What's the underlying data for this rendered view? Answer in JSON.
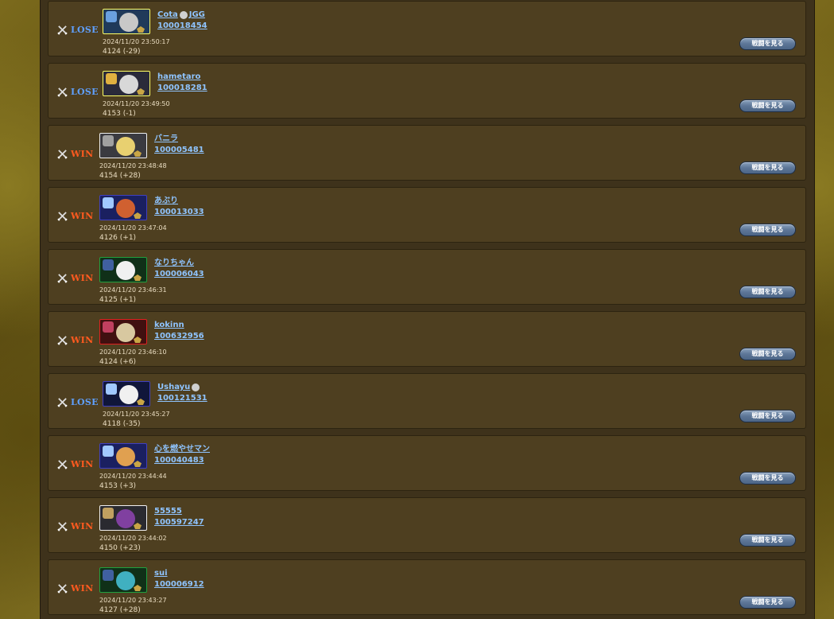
{
  "colors": {
    "win": "#ff5a1f",
    "lose": "#5fa0ff",
    "link": "#8fc4ff",
    "row_bg": "#4e3f20"
  },
  "icons": {
    "result": "crossed-swords-icon"
  },
  "rows": [
    {
      "result": "LOSE",
      "name": "Cota",
      "name_suffix": "JGG",
      "has_mid_icon": true,
      "player_id": "100018454",
      "datetime": "2024/11/20 23:50:17",
      "rating": "4124 (-29)",
      "button": "戦闘を見る",
      "frame": "#ffff66",
      "avatar_bg": "#203a5a",
      "face": "#c8c8c8",
      "char": "#6aa0e0"
    },
    {
      "result": "LOSE",
      "name": "hametaro",
      "name_suffix": "",
      "has_mid_icon": false,
      "player_id": "100018281",
      "datetime": "2024/11/20 23:49:50",
      "rating": "4153 (-1)",
      "button": "戦闘を見る",
      "frame": "#ffff66",
      "avatar_bg": "#2a2a3a",
      "face": "#d8d8d8",
      "char": "#e0b040"
    },
    {
      "result": "WIN",
      "name": "バニラ",
      "name_suffix": "",
      "has_mid_icon": false,
      "player_id": "100005481",
      "datetime": "2024/11/20 23:48:48",
      "rating": "4154 (+28)",
      "button": "戦闘を見る",
      "frame": "#f0f0f0",
      "avatar_bg": "#3a3a40",
      "face": "#e8d070",
      "char": "#a0a0a0"
    },
    {
      "result": "WIN",
      "name": "あぶり",
      "name_suffix": "",
      "has_mid_icon": false,
      "player_id": "100013033",
      "datetime": "2024/11/20 23:47:04",
      "rating": "4126 (+1)",
      "button": "戦闘を見る",
      "frame": "#4040c0",
      "avatar_bg": "#1a2060",
      "face": "#d06030",
      "char": "#a0c8ff"
    },
    {
      "result": "WIN",
      "name": "なりちゃん",
      "name_suffix": "",
      "has_mid_icon": false,
      "player_id": "100006043",
      "datetime": "2024/11/20 23:46:31",
      "rating": "4125 (+1)",
      "button": "戦闘を見る",
      "frame": "#20a040",
      "avatar_bg": "#103018",
      "face": "#f0f0f0",
      "char": "#4060a0"
    },
    {
      "result": "WIN",
      "name": "kokinn",
      "name_suffix": "",
      "has_mid_icon": false,
      "player_id": "100632956",
      "datetime": "2024/11/20 23:46:10",
      "rating": "4124 (+6)",
      "button": "戦闘を見る",
      "frame": "#e02020",
      "avatar_bg": "#401010",
      "face": "#d8c8a0",
      "char": "#c04060"
    },
    {
      "result": "LOSE",
      "name": "Ushayu",
      "name_suffix": "",
      "has_mid_icon": true,
      "player_id": "100121531",
      "datetime": "2024/11/20 23:45:27",
      "rating": "4118 (-35)",
      "button": "戦闘を見る",
      "frame": "#4040c0",
      "avatar_bg": "#10163a",
      "face": "#f0f0f0",
      "char": "#a0c8ff"
    },
    {
      "result": "WIN",
      "name": "心を燃やせマン",
      "name_suffix": "",
      "has_mid_icon": false,
      "player_id": "100040483",
      "datetime": "2024/11/20 23:44:44",
      "rating": "4153 (+3)",
      "button": "戦闘を見る",
      "frame": "#4040c0",
      "avatar_bg": "#1a2060",
      "face": "#e0a050",
      "char": "#a0c8ff"
    },
    {
      "result": "WIN",
      "name": "55555",
      "name_suffix": "",
      "has_mid_icon": false,
      "player_id": "100597247",
      "datetime": "2024/11/20 23:44:02",
      "rating": "4150 (+23)",
      "button": "戦闘を見る",
      "frame": "#f0f0f0",
      "avatar_bg": "#2a2a30",
      "face": "#8040a0",
      "char": "#c0a060"
    },
    {
      "result": "WIN",
      "name": "sui",
      "name_suffix": "",
      "has_mid_icon": false,
      "player_id": "100006912",
      "datetime": "2024/11/20 23:43:27",
      "rating": "4127 (+28)",
      "button": "戦闘を見る",
      "frame": "#20a040",
      "avatar_bg": "#103018",
      "face": "#40b0c0",
      "char": "#4060a0"
    }
  ]
}
